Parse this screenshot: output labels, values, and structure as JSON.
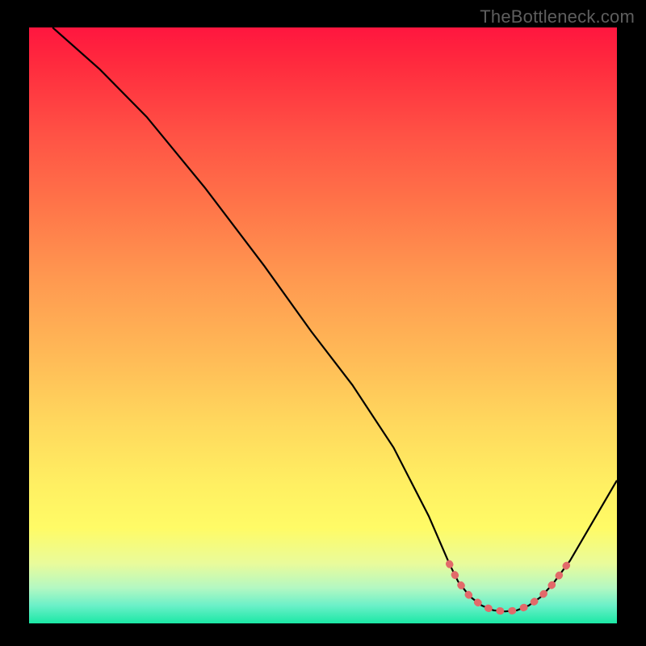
{
  "watermark": "TheBottleneck.com",
  "chart_data": {
    "type": "line",
    "title": "",
    "xlabel": "",
    "ylabel": "",
    "xlim": [
      0,
      100
    ],
    "ylim": [
      0,
      100
    ],
    "series": [
      {
        "name": "curve",
        "color": "#000000",
        "x": [
          4,
          12,
          20,
          30,
          40,
          48,
          55,
          62,
          68,
          71.5,
          73,
          75,
          77,
          79,
          81,
          83,
          85,
          87,
          89,
          92,
          100
        ],
        "y": [
          100,
          93,
          85,
          73,
          60,
          49,
          40,
          29.5,
          18,
          10,
          7,
          4.5,
          3,
          2.2,
          2,
          2.2,
          3,
          4.4,
          6.5,
          10.5,
          24
        ]
      },
      {
        "name": "highlight",
        "color": "#e26a6a",
        "x": [
          71.5,
          73,
          75,
          77,
          79,
          81,
          83,
          85,
          87,
          89,
          92
        ],
        "y": [
          10,
          7,
          4.5,
          3,
          2.2,
          2,
          2.2,
          3,
          4.4,
          6.5,
          10.5
        ]
      }
    ]
  }
}
